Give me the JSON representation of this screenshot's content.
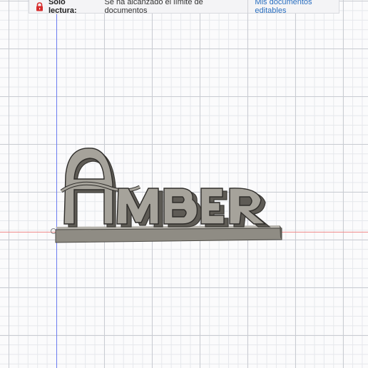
{
  "banner": {
    "lock_icon": "lock-icon",
    "readonly_label": "Solo lectura:",
    "limit_message": "Se ha alcanzado el límite de documentos",
    "editable_docs_link": "Mis documentos editables",
    "lock_color": "#d62b2b",
    "link_color": "#2a6fc0"
  },
  "viewport": {
    "x_axis_color": "#f08a8a",
    "y_axis_color": "#6b7cf0"
  },
  "model": {
    "text": "Amber",
    "face_color": "#9d9a92",
    "side_color": "#6e6b64",
    "base_color": "#8f8c84"
  }
}
